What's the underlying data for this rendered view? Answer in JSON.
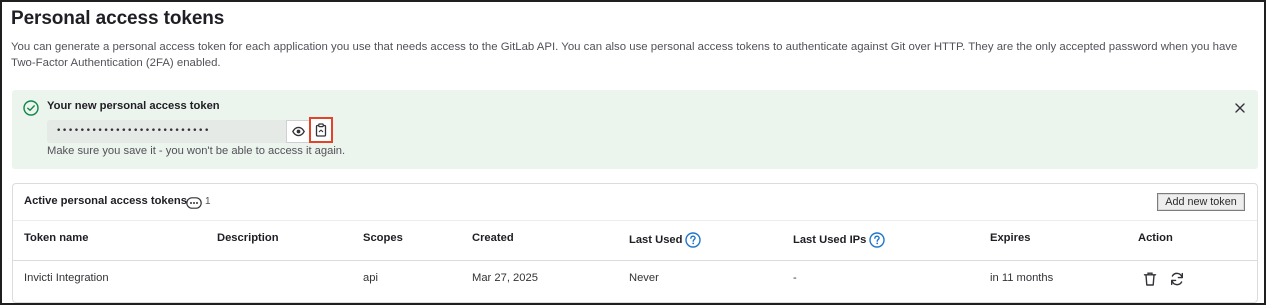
{
  "page": {
    "title": "Personal access tokens",
    "description": "You can generate a personal access token for each application you use that needs access to the GitLab API. You can also use personal access tokens to authenticate against Git over HTTP. They are the only accepted password when you have Two-Factor Authentication (2FA) enabled."
  },
  "alert": {
    "title": "Your new personal access token",
    "token_masked": "••••••••••••••••••••••••••",
    "note": "Make sure you save it - you won't be able to access it again.",
    "icons": {
      "status": "check-circle-icon",
      "close": "close-icon",
      "reveal": "eye-icon",
      "copy": "clipboard-icon"
    },
    "color": "#108548"
  },
  "tokens_card": {
    "title": "Active personal access tokens",
    "count": "1",
    "add_button": "Add new token",
    "columns": {
      "name": "Token name",
      "description": "Description",
      "scopes": "Scopes",
      "created": "Created",
      "last_used": "Last Used",
      "last_used_ips": "Last Used IPs",
      "expires": "Expires",
      "action": "Action"
    },
    "rows": [
      {
        "name": "Invicti Integration",
        "description": "",
        "scopes": "api",
        "created": "Mar 27, 2025",
        "last_used": "Never",
        "last_used_ips": "-",
        "expires": "in 11 months"
      }
    ],
    "accent": "#1f75cb"
  }
}
